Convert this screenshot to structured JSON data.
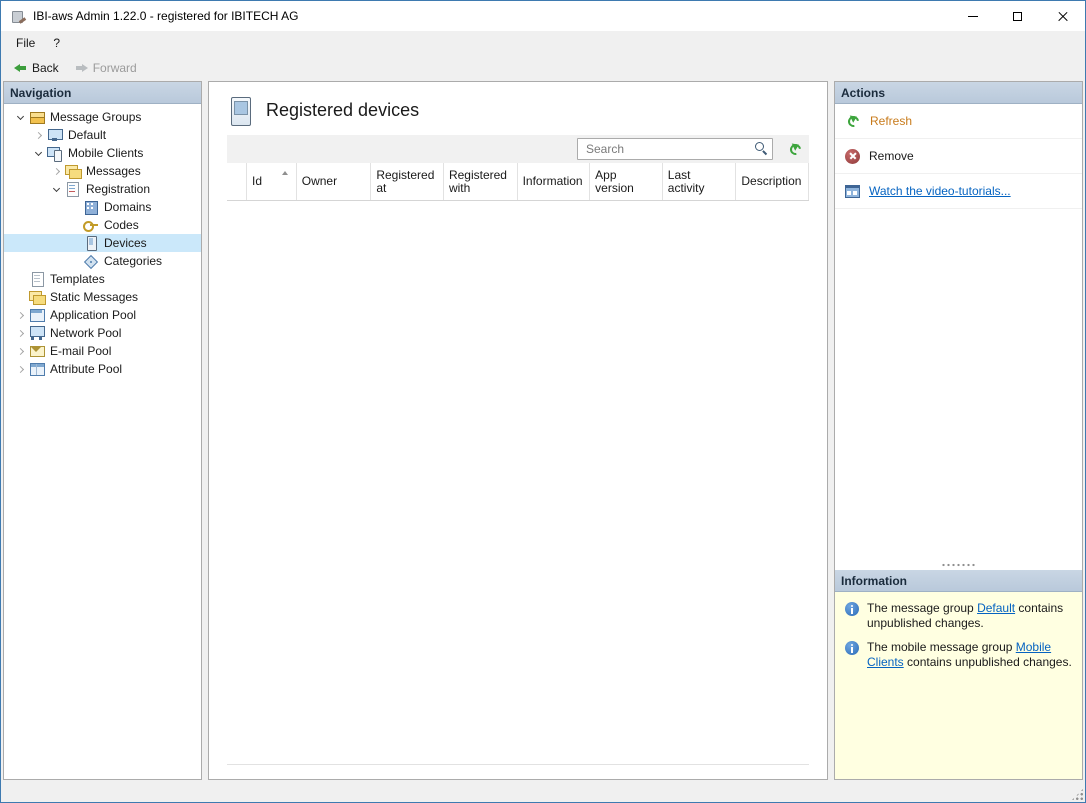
{
  "window": {
    "title": "IBI-aws Admin 1.22.0 - registered for IBITECH AG"
  },
  "menu": {
    "items": [
      "File",
      "?"
    ]
  },
  "toolbar": {
    "back": "Back",
    "forward": "Forward"
  },
  "navigation": {
    "header": "Navigation",
    "tree": [
      {
        "label": "Message Groups",
        "icon": "message-groups-icon",
        "state": "expanded",
        "level": 0
      },
      {
        "label": "Default",
        "icon": "default-group-icon",
        "state": "collapsed",
        "level": 1
      },
      {
        "label": "Mobile Clients",
        "icon": "mobile-clients-icon",
        "state": "expanded",
        "level": 1
      },
      {
        "label": "Messages",
        "icon": "messages-icon",
        "state": "collapsed",
        "level": 2
      },
      {
        "label": "Registration",
        "icon": "registration-icon",
        "state": "expanded",
        "level": 2
      },
      {
        "label": "Domains",
        "icon": "domains-icon",
        "state": "leaf",
        "level": 3
      },
      {
        "label": "Codes",
        "icon": "codes-key-icon",
        "state": "leaf",
        "level": 3
      },
      {
        "label": "Devices",
        "icon": "devices-icon",
        "state": "leaf",
        "level": 3,
        "selected": true
      },
      {
        "label": "Categories",
        "icon": "categories-icon",
        "state": "leaf",
        "level": 3
      },
      {
        "label": "Templates",
        "icon": "templates-icon",
        "state": "leaf",
        "level": 0
      },
      {
        "label": "Static Messages",
        "icon": "static-messages-icon",
        "state": "leaf",
        "level": 0
      },
      {
        "label": "Application Pool",
        "icon": "application-pool-icon",
        "state": "collapsed",
        "level": 0
      },
      {
        "label": "Network Pool",
        "icon": "network-pool-icon",
        "state": "collapsed",
        "level": 0
      },
      {
        "label": "E-mail Pool",
        "icon": "email-pool-icon",
        "state": "collapsed",
        "level": 0
      },
      {
        "label": "Attribute Pool",
        "icon": "attribute-pool-icon",
        "state": "collapsed",
        "level": 0
      }
    ]
  },
  "main": {
    "title": "Registered devices",
    "search": {
      "placeholder": "Search"
    },
    "table": {
      "columns": [
        "Id",
        "Owner",
        "Registered at",
        "Registered with",
        "Information",
        "App version",
        "Last activity",
        "Description"
      ],
      "sort": {
        "column": "Id",
        "direction": "ascending"
      },
      "rows": []
    }
  },
  "actions": {
    "header": "Actions",
    "items": [
      {
        "label": "Refresh",
        "icon": "refresh-icon",
        "style": "link-orange"
      },
      {
        "label": "Remove",
        "icon": "remove-icon",
        "style": "plain"
      },
      {
        "label": "Watch the video-tutorials...",
        "icon": "video-tutorials-icon",
        "style": "link-blue"
      }
    ]
  },
  "information": {
    "header": "Information",
    "notes": [
      {
        "text_before": "The message group ",
        "link": "Default",
        "text_after": " contains unpublished changes."
      },
      {
        "text_before": "The mobile message group ",
        "link": "Mobile Clients",
        "text_after": " contains unpublished changes."
      }
    ]
  },
  "colors": {
    "selection_bg": "#CBE8FA",
    "panel_header_bg": "#BFCDDD",
    "info_panel_bg": "#FFFFE1",
    "link_blue": "#0563C1",
    "refresh_link_orange": "#C87B1B",
    "back_arrow_green": "#3C9E3C"
  }
}
